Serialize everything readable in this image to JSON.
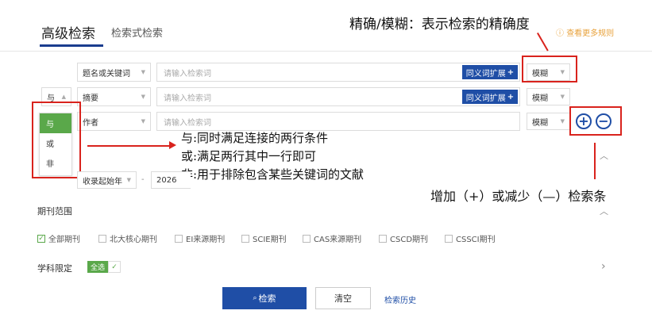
{
  "tabs": {
    "advanced": "高级检索",
    "expression": "检索式检索"
  },
  "more_rules": "查看更多规则",
  "rows": [
    {
      "logic": "",
      "field": "题名或关键词",
      "placeholder": "请输入检索词",
      "synonym": "同义词扩展",
      "match": "模糊"
    },
    {
      "logic": "与",
      "field": "摘要",
      "placeholder": "请输入检索词",
      "synonym": "同义词扩展",
      "match": "模糊"
    },
    {
      "logic": "",
      "field": "作者",
      "placeholder": "请输入检索词",
      "synonym": "",
      "match": "模糊"
    }
  ],
  "logic_options": [
    "与",
    "或",
    "非"
  ],
  "time_row": {
    "start": "收录起始年",
    "dash": "-",
    "end": "2026"
  },
  "journal_range": {
    "label": "期刊范围",
    "options": [
      "全部期刊",
      "北大核心期刊",
      "EI来源期刊",
      "SCIE期刊",
      "CAS来源期刊",
      "CSCD期刊",
      "CSSCI期刊"
    ]
  },
  "subject": {
    "label": "学科限定",
    "select_all": "全选"
  },
  "actions": {
    "search": "检索",
    "clear": "清空",
    "history": "检索历史"
  },
  "annotations": {
    "precision": "精确/模糊：表示检索的精确度",
    "logic_and": "与:同时满足连接的两行条件",
    "logic_or": "或:满足两行其中一行即可",
    "logic_not": "非:用于排除包含某些关键词的文献",
    "add_remove": "增加（+）或减少（—）检索条"
  },
  "icons": {
    "add": "+",
    "remove": "−",
    "plus_small": "+",
    "up": "▲",
    "down": "▼",
    "collapse": "︿",
    "expand": "›",
    "check": "✓",
    "search": "🔍"
  },
  "colors": {
    "primary": "#1f4ea6",
    "accent_green": "#5aa84a",
    "annotation_red": "#d9231d",
    "link_orange": "#e8a23c"
  }
}
